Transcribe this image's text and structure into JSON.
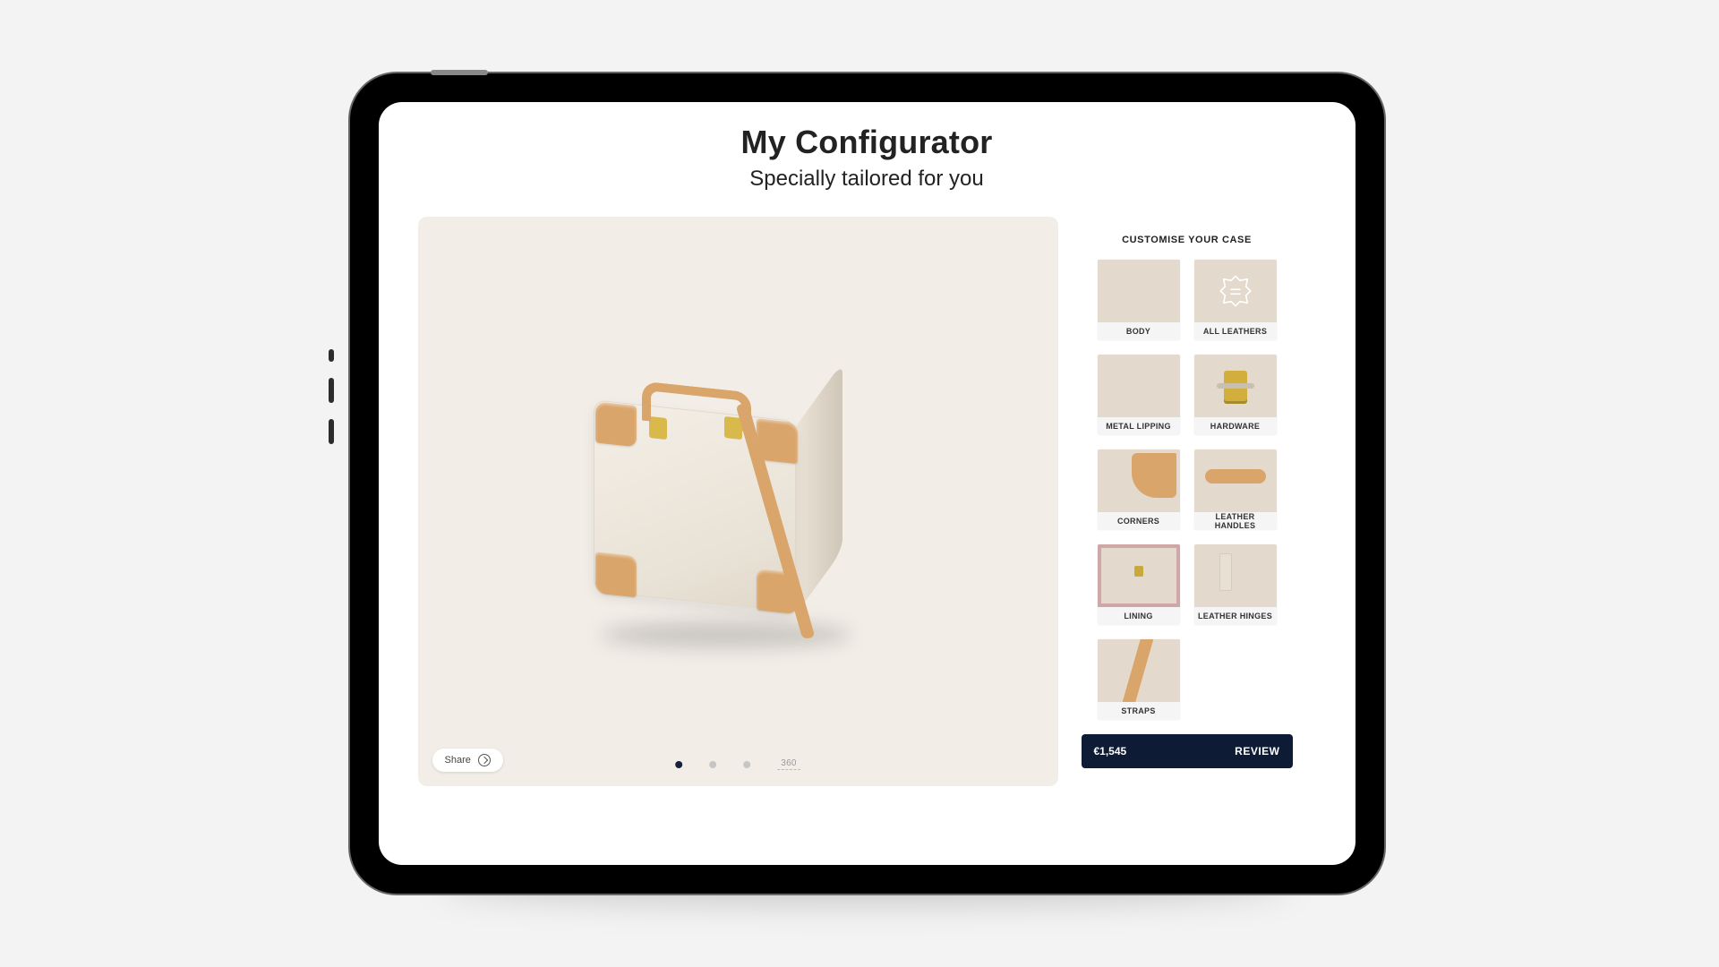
{
  "header": {
    "title": "My Configurator",
    "subtitle": "Specially tailored for you"
  },
  "preview": {
    "share_label": "Share",
    "badge_360": "360",
    "active_page_index": 0,
    "page_count": 3
  },
  "side": {
    "title": "CUSTOMISE YOUR CASE",
    "options": [
      {
        "id": "body",
        "label": "BODY",
        "thumb": "th-body"
      },
      {
        "id": "all-leathers",
        "label": "ALL LEATHERS",
        "thumb": "th-all-leathers"
      },
      {
        "id": "metal-lipping",
        "label": "METAL LIPPING",
        "thumb": "th-metal-lipping"
      },
      {
        "id": "hardware",
        "label": "HARDWARE",
        "thumb": "th-hardware"
      },
      {
        "id": "corners",
        "label": "CORNERS",
        "thumb": "th-corners"
      },
      {
        "id": "leather-handles",
        "label": "LEATHER HANDLES",
        "thumb": "th-leather-handles"
      },
      {
        "id": "lining",
        "label": "LINING",
        "thumb": "th-lining"
      },
      {
        "id": "leather-hinges",
        "label": "LEATHER HINGES",
        "thumb": "th-leather-hinges"
      },
      {
        "id": "straps",
        "label": "STRAPS",
        "thumb": "th-straps"
      }
    ]
  },
  "footer": {
    "price": "€1,545",
    "review_label": "REVIEW"
  }
}
